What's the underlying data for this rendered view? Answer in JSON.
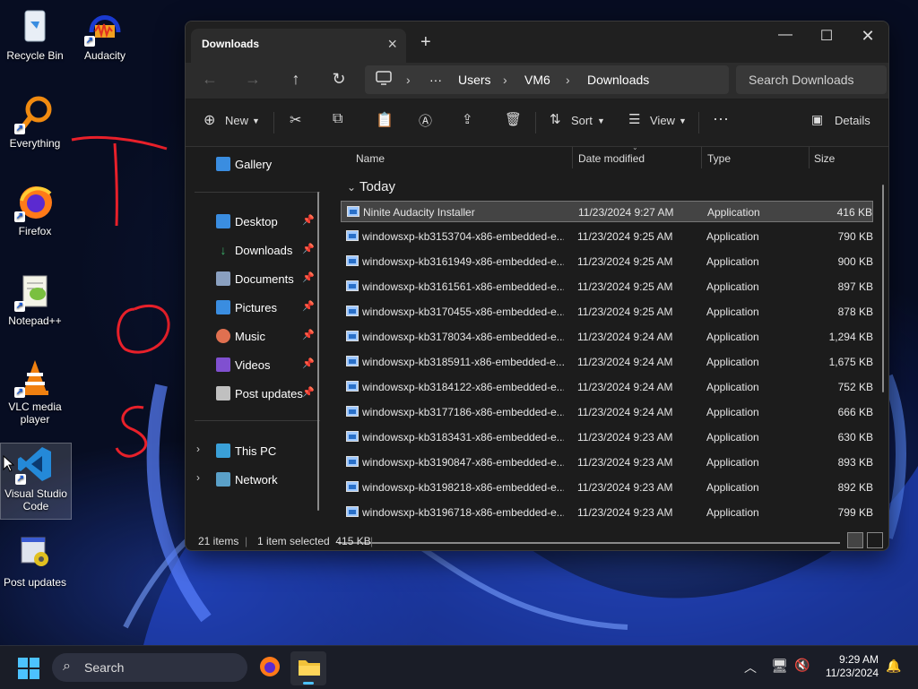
{
  "desktop": {
    "icons": [
      {
        "label": "Recycle Bin"
      },
      {
        "label": "Audacity"
      },
      {
        "label": "Everything"
      },
      {
        "label": "Firefox"
      },
      {
        "label": "Notepad++"
      },
      {
        "label": "VLC media player"
      },
      {
        "label": "Visual Studio Code"
      },
      {
        "label": "Post updates"
      }
    ]
  },
  "window": {
    "tab_title": "Downloads",
    "breadcrumb": [
      "Users",
      "VM6",
      "Downloads"
    ],
    "search_placeholder": "Search Downloads",
    "toolbar": {
      "new_label": "New",
      "sort_label": "Sort",
      "view_label": "View",
      "details_label": "Details"
    },
    "nav": {
      "gallery": "Gallery",
      "quick_access": [
        {
          "label": "Desktop",
          "color": "#3a8de0"
        },
        {
          "label": "Downloads",
          "color": "#3ab06a"
        },
        {
          "label": "Documents",
          "color": "#8aa0c0"
        },
        {
          "label": "Pictures",
          "color": "#3a8de0"
        },
        {
          "label": "Music",
          "color": "#e07050"
        },
        {
          "label": "Videos",
          "color": "#8050d0"
        },
        {
          "label": "Post updates",
          "color": "#c0c0c0"
        }
      ],
      "this_pc": "This PC",
      "network": "Network"
    },
    "columns": {
      "name": "Name",
      "date": "Date modified",
      "type": "Type",
      "size": "Size"
    },
    "group_label": "Today",
    "files": [
      {
        "name": "Ninite Audacity Installer",
        "date": "11/23/2024 9:27 AM",
        "type": "Application",
        "size": "416 KB",
        "selected": true
      },
      {
        "name": "windowsxp-kb3153704-x86-embedded-e...",
        "date": "11/23/2024 9:25 AM",
        "type": "Application",
        "size": "790 KB"
      },
      {
        "name": "windowsxp-kb3161949-x86-embedded-e...",
        "date": "11/23/2024 9:25 AM",
        "type": "Application",
        "size": "900 KB"
      },
      {
        "name": "windowsxp-kb3161561-x86-embedded-e...",
        "date": "11/23/2024 9:25 AM",
        "type": "Application",
        "size": "897 KB"
      },
      {
        "name": "windowsxp-kb3170455-x86-embedded-e...",
        "date": "11/23/2024 9:25 AM",
        "type": "Application",
        "size": "878 KB"
      },
      {
        "name": "windowsxp-kb3178034-x86-embedded-e...",
        "date": "11/23/2024 9:24 AM",
        "type": "Application",
        "size": "1,294 KB"
      },
      {
        "name": "windowsxp-kb3185911-x86-embedded-e...",
        "date": "11/23/2024 9:24 AM",
        "type": "Application",
        "size": "1,675 KB"
      },
      {
        "name": "windowsxp-kb3184122-x86-embedded-e...",
        "date": "11/23/2024 9:24 AM",
        "type": "Application",
        "size": "752 KB"
      },
      {
        "name": "windowsxp-kb3177186-x86-embedded-e...",
        "date": "11/23/2024 9:24 AM",
        "type": "Application",
        "size": "666 KB"
      },
      {
        "name": "windowsxp-kb3183431-x86-embedded-e...",
        "date": "11/23/2024 9:23 AM",
        "type": "Application",
        "size": "630 KB"
      },
      {
        "name": "windowsxp-kb3190847-x86-embedded-e...",
        "date": "11/23/2024 9:23 AM",
        "type": "Application",
        "size": "893 KB"
      },
      {
        "name": "windowsxp-kb3198218-x86-embedded-e...",
        "date": "11/23/2024 9:23 AM",
        "type": "Application",
        "size": "892 KB"
      },
      {
        "name": "windowsxp-kb3196718-x86-embedded-e...",
        "date": "11/23/2024 9:23 AM",
        "type": "Application",
        "size": "799 KB"
      }
    ],
    "status": {
      "count": "21 items",
      "selection": "1 item selected  415 KB"
    }
  },
  "taskbar": {
    "search_label": "Search",
    "time": "9:29 AM",
    "date": "11/23/2024"
  },
  "colors": {
    "accent": "#3a8de0",
    "window_bg": "#1c1c1c",
    "ink": "#e8202a"
  }
}
